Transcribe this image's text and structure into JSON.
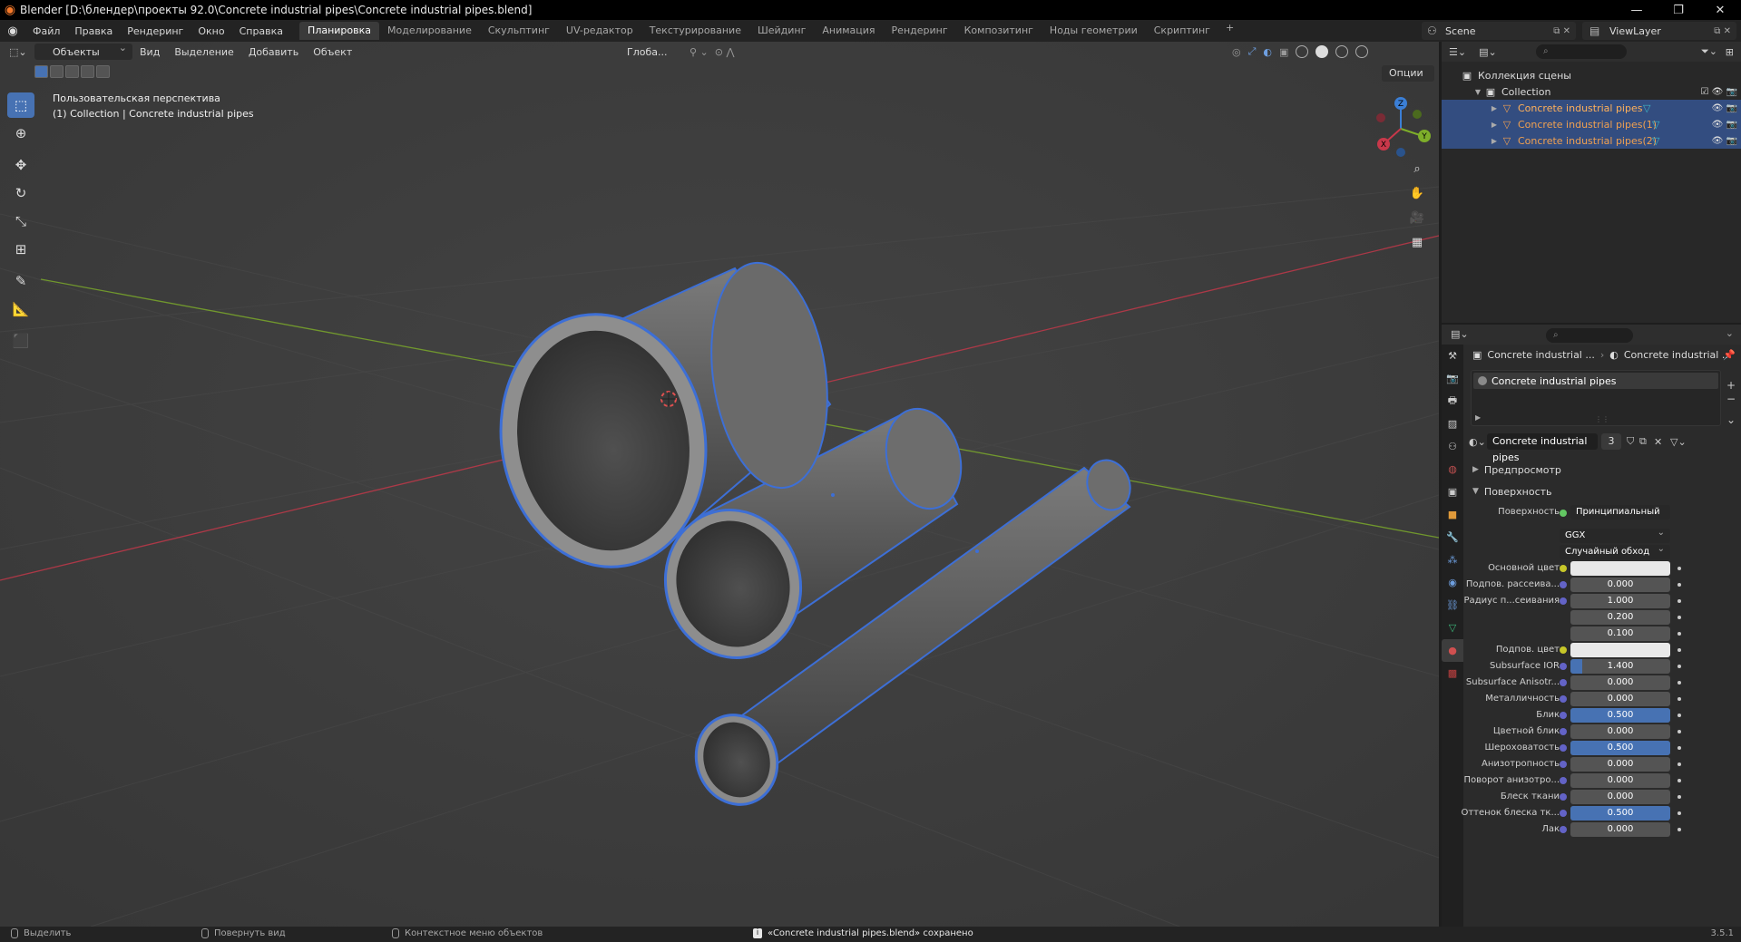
{
  "window": {
    "title": "Blender [D:\\блендер\\проекты 92.0\\Concrete industrial pipes\\Concrete industrial pipes.blend]",
    "controls": [
      "—",
      "❐",
      "✕"
    ]
  },
  "menubar": {
    "items": [
      "Файл",
      "Правка",
      "Рендеринг",
      "Окно",
      "Справка"
    ],
    "workspaces": [
      "Планировка",
      "Моделирование",
      "Скульптинг",
      "UV-редактор",
      "Текстурирование",
      "Шейдинг",
      "Анимация",
      "Рендеринг",
      "Композитинг",
      "Ноды геометрии",
      "Скриптинг"
    ],
    "active_workspace": "Планировка",
    "plus": "+",
    "scene": "Scene",
    "view_layer": "ViewLayer"
  },
  "viewport": {
    "mode": "Объекты",
    "menus": [
      "Вид",
      "Выделение",
      "Добавить",
      "Объект"
    ],
    "orientation": "Глоба...",
    "options": "Опции",
    "info_line1": "Пользовательская перспектива",
    "info_line2": "(1) Collection | Concrete industrial pipes",
    "gizmo_axes": [
      "Z",
      "Y",
      "X"
    ]
  },
  "outliner": {
    "search_placeholder": "",
    "scene_collection": "Коллекция сцены",
    "collection": "Collection",
    "objects": [
      "Concrete industrial pipes",
      "Concrete industrial pipes(1)",
      "Concrete industrial pipes(2)"
    ]
  },
  "properties": {
    "breadcrumb_obj": "Concrete industrial ...",
    "breadcrumb_mat": "Concrete industrial ...",
    "slot": "Concrete industrial pipes",
    "material_name": "Concrete industrial pipes",
    "material_users": "3",
    "panel_preview": "Предпросмотр",
    "panel_surface": "Поверхность",
    "surface_label": "Поверхность",
    "surface_value": "Принципиальный BSDF",
    "distribution": "GGX",
    "subsurface_method": "Случайный обход",
    "rows": [
      {
        "label": "Основной цвет",
        "type": "color",
        "value": ""
      },
      {
        "label": "Подпов. рассеива...",
        "type": "num",
        "value": "0.000",
        "fill": 0
      },
      {
        "label": "Радиус п...сеивания",
        "type": "num",
        "value": "1.000",
        "fill": 0
      },
      {
        "label": "",
        "type": "num",
        "value": "0.200",
        "fill": 0
      },
      {
        "label": "",
        "type": "num",
        "value": "0.100",
        "fill": 0
      },
      {
        "label": "Подпов. цвет",
        "type": "color",
        "value": ""
      },
      {
        "label": "Subsurface IOR",
        "type": "num",
        "value": "1.400",
        "fill": 0.12
      },
      {
        "label": "Subsurface Anisotr...",
        "type": "num",
        "value": "0.000",
        "fill": 0
      },
      {
        "label": "Металличность",
        "type": "num",
        "value": "0.000",
        "fill": 0
      },
      {
        "label": "Блик",
        "type": "num",
        "value": "0.500",
        "fill": 1
      },
      {
        "label": "Цветной блик",
        "type": "num",
        "value": "0.000",
        "fill": 0
      },
      {
        "label": "Шероховатость",
        "type": "num",
        "value": "0.500",
        "fill": 1
      },
      {
        "label": "Анизотропность",
        "type": "num",
        "value": "0.000",
        "fill": 0
      },
      {
        "label": "Поворот анизотро...",
        "type": "num",
        "value": "0.000",
        "fill": 0
      },
      {
        "label": "Блеск ткани",
        "type": "num",
        "value": "0.000",
        "fill": 0
      },
      {
        "label": "Оттенок блеска тк...",
        "type": "num",
        "value": "0.500",
        "fill": 1
      },
      {
        "label": "Лак",
        "type": "num",
        "value": "0.000",
        "fill": 0
      }
    ]
  },
  "statusbar": {
    "select": "Выделить",
    "rotate": "Повернуть вид",
    "context": "Контекстное меню объектов",
    "notice": "«Concrete industrial pipes.blend» сохранено",
    "version": "3.5.1"
  },
  "colors": {
    "accent": "#4772b3",
    "selection_outline": "#3d6fd6",
    "x_axis": "#c8384a",
    "y_axis": "#7eae2a",
    "z_axis": "#3b7fd6"
  }
}
